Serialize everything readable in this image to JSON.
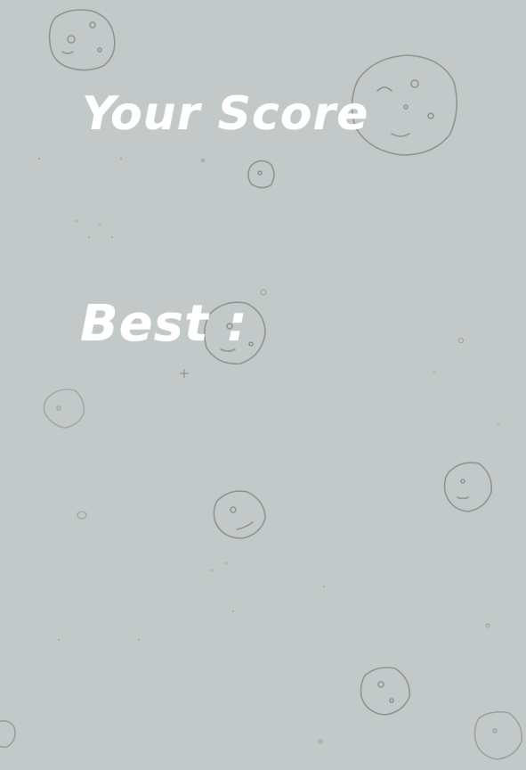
{
  "game_over": {
    "score_label": "Your Score",
    "best_label": "Best :"
  },
  "theme": {
    "background": "#c3c9c8",
    "text_color": "#ffffff",
    "asteroid_stroke": "#8f9594"
  },
  "icons": [
    "asteroid-icon",
    "sparkle-icon"
  ]
}
